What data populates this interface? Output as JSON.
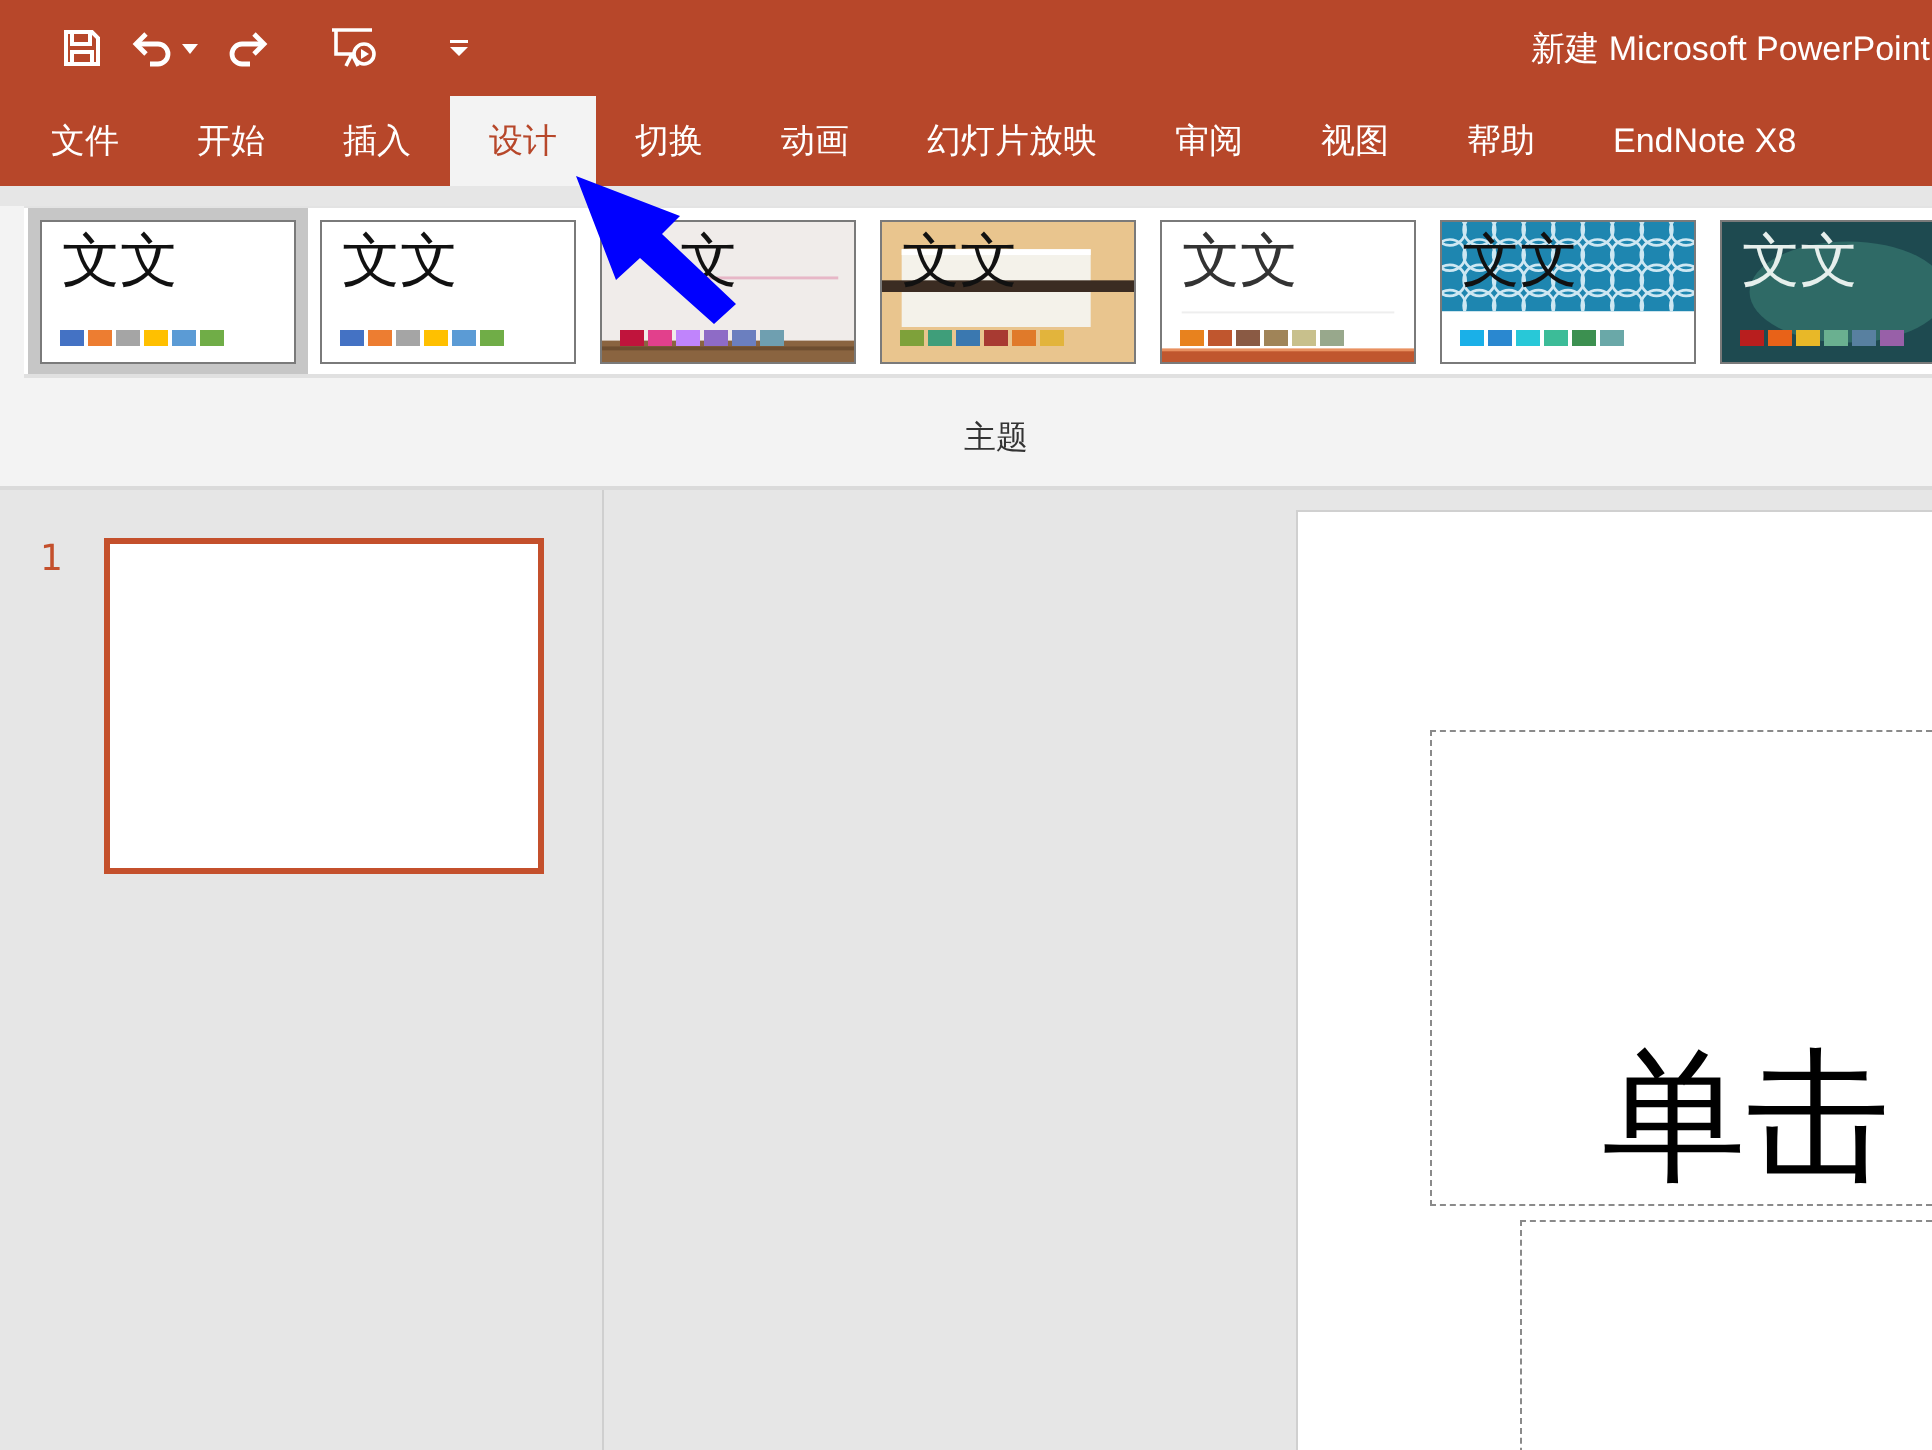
{
  "window": {
    "title": "新建 Microsoft PowerPoint"
  },
  "quick_access": [
    {
      "kind": "save"
    },
    {
      "kind": "undo"
    },
    {
      "kind": "dropdown"
    },
    {
      "kind": "redo"
    },
    {
      "kind": "slideshow"
    },
    {
      "kind": "customize"
    }
  ],
  "tabs": [
    {
      "label": "文件",
      "selected": false
    },
    {
      "label": "开始",
      "selected": false
    },
    {
      "label": "插入",
      "selected": false
    },
    {
      "label": "设计",
      "selected": true
    },
    {
      "label": "切换",
      "selected": false
    },
    {
      "label": "动画",
      "selected": false
    },
    {
      "label": "幻灯片放映",
      "selected": false
    },
    {
      "label": "审阅",
      "selected": false
    },
    {
      "label": "视图",
      "selected": false
    },
    {
      "label": "帮助",
      "selected": false
    },
    {
      "label": "EndNote X8",
      "selected": false
    }
  ],
  "ribbon": {
    "group_label": "主题",
    "themes": [
      {
        "kind": "plain",
        "text": "文文",
        "selected": true,
        "swatches": [
          {
            "color": "#4472c4"
          },
          {
            "color": "#ed7d31"
          },
          {
            "color": "#a5a5a5"
          },
          {
            "color": "#ffc000"
          },
          {
            "color": "#5b9bd5"
          },
          {
            "color": "#70ad47"
          }
        ]
      },
      {
        "kind": "plain",
        "text": "文文",
        "selected": false,
        "swatches": [
          {
            "color": "#4472c4"
          },
          {
            "color": "#ed7d31"
          },
          {
            "color": "#a5a5a5"
          },
          {
            "color": "#ffc000"
          },
          {
            "color": "#5b9bd5"
          },
          {
            "color": "#70ad47"
          }
        ]
      },
      {
        "kind": "wood",
        "text": "文",
        "selected": false,
        "swatches": [
          {
            "color": "#c0143c"
          },
          {
            "color": "#e2408c"
          },
          {
            "color": "#c084fc"
          },
          {
            "color": "#8e6bc6"
          },
          {
            "color": "#6b7fbf"
          },
          {
            "color": "#6f9fb0"
          }
        ]
      },
      {
        "kind": "paper",
        "text": "文文",
        "selected": false,
        "swatches": [
          {
            "color": "#7ea13a"
          },
          {
            "color": "#3f9e7a"
          },
          {
            "color": "#3a78b0"
          },
          {
            "color": "#a83a32"
          },
          {
            "color": "#e07a2a"
          },
          {
            "color": "#e2b43c"
          }
        ]
      },
      {
        "kind": "banded",
        "text": "文文",
        "selected": false,
        "swatches": [
          {
            "color": "#e8821e"
          },
          {
            "color": "#c0562e"
          },
          {
            "color": "#8a5a44"
          },
          {
            "color": "#a08458"
          },
          {
            "color": "#c8c08c"
          },
          {
            "color": "#98a88c"
          }
        ]
      },
      {
        "kind": "pattern",
        "text": "文文",
        "selected": false,
        "swatches": [
          {
            "color": "#1ab0e8"
          },
          {
            "color": "#2a88d0"
          },
          {
            "color": "#28c8d8"
          },
          {
            "color": "#3cbc98"
          },
          {
            "color": "#3c9050"
          },
          {
            "color": "#6aa8a8"
          }
        ]
      },
      {
        "kind": "chalk",
        "text": "文文",
        "selected": false,
        "swatches": [
          {
            "color": "#b81e1e"
          },
          {
            "color": "#e86218"
          },
          {
            "color": "#e8b828"
          },
          {
            "color": "#6ab090"
          },
          {
            "color": "#5880a0"
          },
          {
            "color": "#9860a8"
          }
        ]
      }
    ]
  },
  "slides": [
    {
      "number": "1",
      "selected": true
    }
  ],
  "slide": {
    "title_placeholder": "单击"
  },
  "annotation": {
    "kind": "arrow"
  }
}
